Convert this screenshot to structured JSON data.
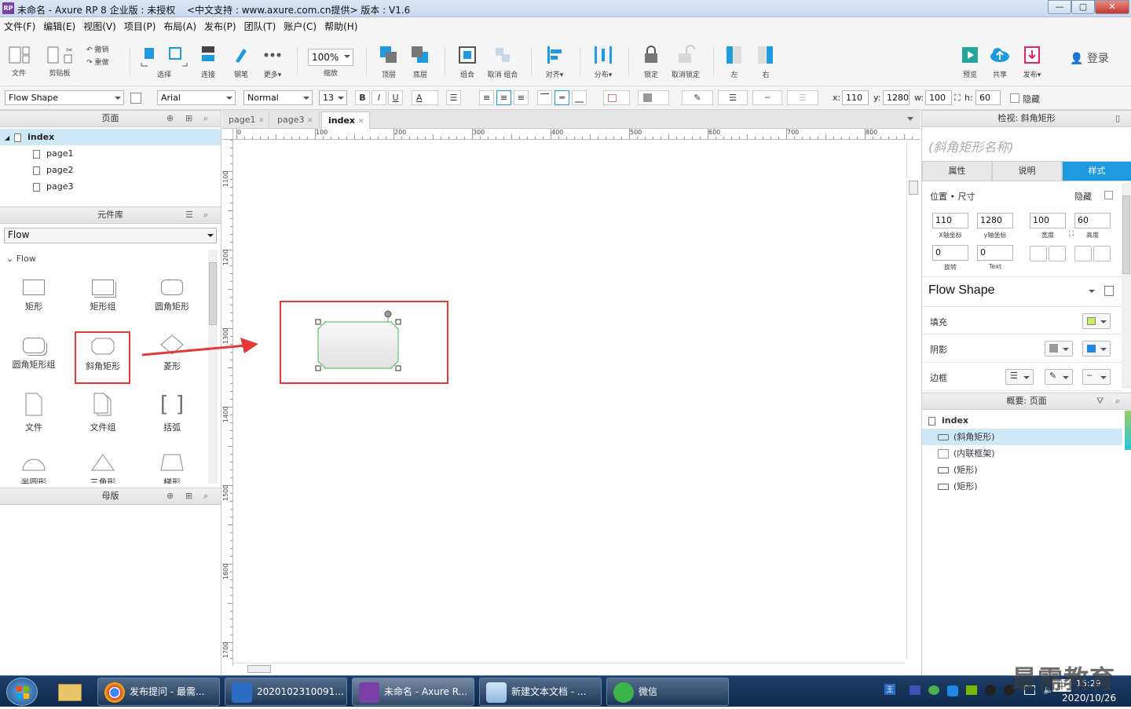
{
  "window": {
    "title": "未命名 - Axure RP 8 企业版 : 未授权",
    "subtitle": "<中文支持 : www.axure.com.cn提供> 版本 : V1.6",
    "logo": "RP",
    "minimize": "—",
    "maximize": "▢",
    "close": "✕",
    "close_color": "#d9423a"
  },
  "menu": [
    "文件(F)",
    "编辑(E)",
    "视图(V)",
    "项目(P)",
    "布局(A)",
    "发布(P)",
    "团队(T)",
    "账户(C)",
    "帮助(H)"
  ],
  "toolbar": {
    "file": "文件",
    "clipboard": "剪贴板",
    "undo": "撤销",
    "redo": "重做",
    "select": "选择",
    "connect": "连接",
    "pen": "钢笔",
    "more": "更多▾",
    "zoom_value": "100%",
    "zoom_label": "缩放",
    "top": "顶层",
    "bottom": "底层",
    "group": "组合",
    "ungroup": "取消 组合",
    "align": "对齐▾",
    "distribute": "分布▾",
    "lock": "锁定",
    "unlock": "取消锁定",
    "left": "左",
    "right": "右",
    "preview": "预览",
    "share": "共享",
    "publish": "发布▾",
    "login": "登录",
    "accent": "#1e9ae0"
  },
  "format": {
    "widget_style": "Flow Shape",
    "font": "Arial",
    "font_weight": "Normal",
    "font_size": "13",
    "bold": "B",
    "italic": "I",
    "underline": "U",
    "font_color": "A",
    "x_label": "x:",
    "x_value": "110",
    "y_label": "y:",
    "y_value": "1280",
    "w_label": "w:",
    "w_value": "100",
    "h_label": "h:",
    "h_value": "60",
    "hidden": "隐藏"
  },
  "pages_panel": {
    "title": "页面",
    "root": "index",
    "pages": [
      "page1",
      "page2",
      "page3"
    ]
  },
  "library_panel": {
    "title": "元件库",
    "library": "Flow",
    "group": "Flow",
    "widgets": [
      "矩形",
      "矩形组",
      "圆角矩形",
      "圆角矩形组",
      "斜角矩形",
      "菱形",
      "文件",
      "文件组",
      "括弧",
      "半圆形",
      "三角形",
      "梯形"
    ],
    "highlight_color": "#e53935"
  },
  "masters_panel": {
    "title": "母版"
  },
  "canvas": {
    "tabs": [
      "page1",
      "page3",
      "index"
    ],
    "active_tab": "index",
    "tab_close": "✕",
    "ruler_h": [
      "0",
      "100",
      "200",
      "300",
      "400",
      "500",
      "600",
      "700",
      "800"
    ],
    "ruler_v": [
      "1100",
      "1200",
      "1300",
      "1400",
      "1500",
      "1600",
      "1700"
    ],
    "shape_stroke": "#4caf50",
    "arrow_color": "#e53935"
  },
  "inspector": {
    "title": "检视: 斜角矩形",
    "name_placeholder": "(斜角矩形名称)",
    "tabs": [
      "属性",
      "说明",
      "样式"
    ],
    "active_tab": "样式",
    "section_pos": "位置 • 尺寸",
    "hidden": "隐藏",
    "x": "110",
    "y": "1280",
    "w": "100",
    "h": "60",
    "x_cap": "X轴坐标",
    "y_cap": "y轴坐标",
    "w_cap": "宽度",
    "h_cap": "高度",
    "rot": "0",
    "text_rot": "0",
    "rot_cap": "旋转",
    "text_cap": "Text",
    "style_name": "Flow Shape",
    "fill": "填充",
    "shadow": "阴影",
    "border": "边框",
    "fill_color": "#c6ef5b",
    "shadow_color": "#1e88e5"
  },
  "outline": {
    "title": "概要: 页面",
    "root": "index",
    "items": [
      "(斜角矩形)",
      "(内联框架)",
      "(矩形)",
      "(矩形)"
    ]
  },
  "taskbar": {
    "tasks": [
      "发布提问 - 最需...",
      "2020102310091...",
      "未命名 - Axure R...",
      "新建文本文档 - ...",
      "微信"
    ],
    "time": "15:29",
    "date": "2020/10/26",
    "watermark": "最需教育",
    "ime": "中"
  }
}
